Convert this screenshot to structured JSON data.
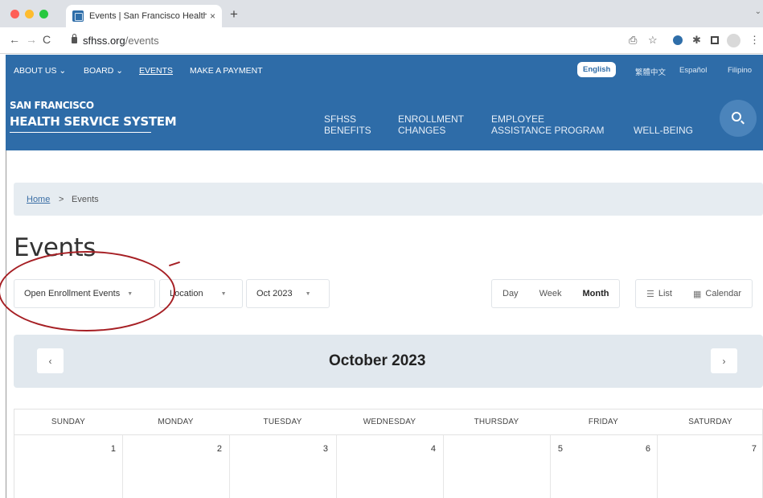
{
  "browser": {
    "tab_title": "Events | San Francisco Health",
    "tab_close": "×",
    "new_tab": "+",
    "tab_menu": "⌄",
    "url_host": "sfhss.org",
    "url_path": "/events",
    "back": "←",
    "forward": "→",
    "reload": "C",
    "share_icon": "⎙",
    "star_icon": "☆",
    "puzzle_icon": "✱",
    "menu_icon": "⋮"
  },
  "topnav": {
    "items": [
      {
        "label": "ABOUT US ⌄"
      },
      {
        "label": "BOARD ⌄"
      },
      {
        "label": "EVENTS"
      },
      {
        "label": "MAKE A PAYMENT"
      }
    ],
    "languages": [
      "English",
      "繁體中文",
      "Español",
      "Filipino"
    ]
  },
  "logo": {
    "line1": "SAN FRANCISCO",
    "line2": "HEALTH SERVICE SYSTEM"
  },
  "mainnav": {
    "items": [
      {
        "line1": "SFHSS",
        "line2": "BENEFITS"
      },
      {
        "line1": "ENROLLMENT",
        "line2": "CHANGES"
      },
      {
        "line1": "EMPLOYEE",
        "line2": "ASSISTANCE PROGRAM"
      },
      {
        "line1": "",
        "line2": "WELL-BEING"
      }
    ]
  },
  "breadcrumb": {
    "home": "Home",
    "separator": ">",
    "current": "Events"
  },
  "page": {
    "title": "Events"
  },
  "filters": {
    "category": "Open Enrollment Events",
    "location": "Location",
    "month": "Oct 2023",
    "caret": "▼"
  },
  "views": {
    "day": "Day",
    "week": "Week",
    "month": "Month",
    "list": "List",
    "calendar": "Calendar",
    "list_icon": "☰",
    "calendar_icon": "▦"
  },
  "calendar": {
    "prev": "‹",
    "next": "›",
    "month_title": "October 2023",
    "weekdays": [
      "SUNDAY",
      "MONDAY",
      "TUESDAY",
      "WEDNESDAY",
      "THURSDAY",
      "FRIDAY",
      "SATURDAY"
    ],
    "first_row_days": [
      "1",
      "2",
      "3",
      "4",
      "5",
      "6",
      "7"
    ]
  },
  "colors": {
    "brand_blue": "#2e6ca8",
    "annotation_red": "#a61f24"
  }
}
